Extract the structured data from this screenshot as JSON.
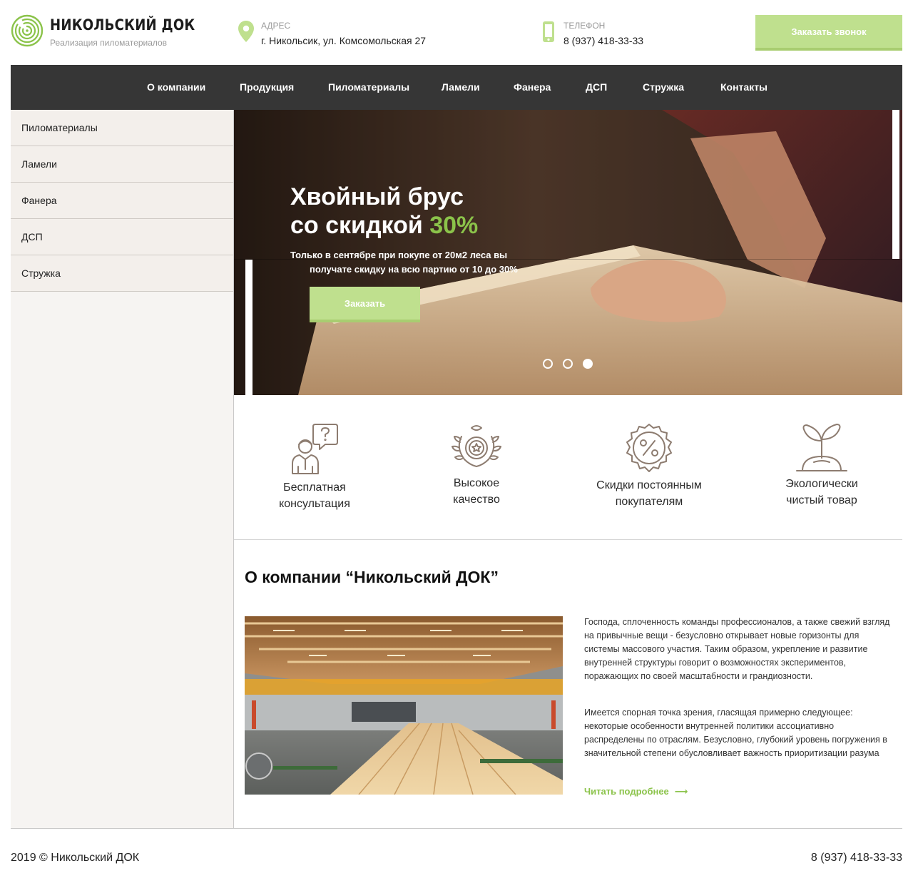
{
  "colors": {
    "accent": "#8bc34a",
    "button": "#bfe08e",
    "nav_bg": "#363636",
    "sidebar_bg": "#f3efeb"
  },
  "header": {
    "logo_name": "НИКОЛЬСКИЙ ДОК",
    "logo_tagline": "Реализация пиломатериалов",
    "address_label": "АДРЕС",
    "address_value": "г. Никольсик, ул. Комсомольская 27",
    "phone_label": "ТЕЛЕФОН",
    "phone_value": "8 (937) 418-33-33",
    "call_button": "Заказать звонок",
    "icons": {
      "address": "map-pin-icon",
      "phone": "smartphone-icon"
    }
  },
  "nav": {
    "items": [
      {
        "label": "О компании"
      },
      {
        "label": "Продукция"
      },
      {
        "label": "Пиломатериалы"
      },
      {
        "label": "Ламели"
      },
      {
        "label": "Фанера"
      },
      {
        "label": "ДСП"
      },
      {
        "label": "Стружка"
      },
      {
        "label": "Контакты"
      }
    ]
  },
  "sidebar": {
    "items": [
      {
        "label": "Пиломатериалы"
      },
      {
        "label": "Ламели"
      },
      {
        "label": "Фанера"
      },
      {
        "label": "ДСП"
      },
      {
        "label": "Стружка"
      }
    ]
  },
  "hero": {
    "title_line1": "Хвойный брус",
    "title_line2": "со скидкой ",
    "title_accent": "30%",
    "text_line1": "Только в сентябре при покупе от 20м2 леса вы",
    "text_line2": "получате скидку на всю партию от 10 до 30%",
    "button": "Заказать",
    "slides_total": 3,
    "active_slide": 3
  },
  "features": [
    {
      "line1": "Бесплатная",
      "line2": "консультация",
      "icon": "consultant-question-icon"
    },
    {
      "line1": "Высокое",
      "line2": "качество",
      "icon": "award-wreath-icon"
    },
    {
      "line1": "Скидки постоянным",
      "line2": "покупателям",
      "icon": "percent-badge-icon"
    },
    {
      "line1": "Экологически",
      "line2": "чистый товар",
      "icon": "sprout-icon"
    }
  ],
  "about": {
    "title": "О компании “Никольский ДОК”",
    "p1": "Господа, сплоченность команды профессионалов, а также свежий взгляд на привычные вещи - безусловно открывает новые горизонты для системы массового участия. Таким образом, укрепление и развитие внутренней структуры говорит о возможностях экспериментов, поражающих по своей масштабности и грандиозности.",
    "p2": "Имеется спорная точка зрения, гласящая примерно следующее: некоторые особенности внутренней политики ассоциативно распределены по отраслям. Безусловно, глубокий уровень погружения в значительной степени обусловливает важность приоритизации разума",
    "read_more": "Читать подробнее",
    "read_more_arrow": "⟶"
  },
  "footer": {
    "copyright": "2019 © Никольский ДОК",
    "phone": "8 (937) 418-33-33"
  }
}
